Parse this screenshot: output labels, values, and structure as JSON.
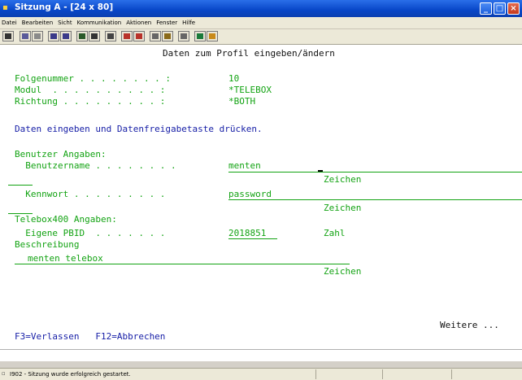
{
  "window": {
    "title": "Sitzung A - [24 x 80]",
    "buttons": [
      "minimize",
      "maximize",
      "close"
    ]
  },
  "menu": [
    "Datei",
    "Bearbeiten",
    "Sicht",
    "Kommunikation",
    "Aktionen",
    "Fenster",
    "Hilfe"
  ],
  "toolbar": {
    "icons": [
      "print-screen-icon",
      "copy-icon",
      "paste-icon",
      "send-icon",
      "receive-icon",
      "display-icon",
      "keyboard-icon",
      "macro-play-icon",
      "record-icon",
      "stop-icon",
      "map-icon",
      "ftp-icon",
      "doc-icon",
      "globe-icon",
      "pencil-icon"
    ]
  },
  "screen": {
    "heading": "Daten zum Profil eingeben/ändern",
    "fields": [
      {
        "label": "Folgenummer . . . . . . . . :",
        "value": "10"
      },
      {
        "label": "Modul  . . . . . . . . . . :",
        "value": "*TELEBOX"
      },
      {
        "label": "Richtung . . . . . . . . . :",
        "value": "*BOTH"
      }
    ],
    "instruction": "Daten eingeben und Datenfreigabetaste drücken.",
    "section_user": "Benutzer Angaben:",
    "username_label": "  Benutzername . . . . . . . .",
    "username_value": "menten",
    "username_hint": "Zeichen",
    "password_label": "  Kennwort . . . . . . . . .",
    "password_value": "password",
    "password_hint": "Zeichen",
    "section_telebox": "Telebox400 Angaben:",
    "pbid_label": "  Eigene PBID  . . . . . . .",
    "pbid_value": "2018851",
    "pbid_hint": "Zahl",
    "description_label": "Beschreibung",
    "description_value": "menten telebox",
    "description_hint": "Zeichen",
    "more": "Weitere ...",
    "fkeys": "F3=Verlassen   F12=Abbrechen"
  },
  "status": {
    "message": "I902 - Sitzung wurde erfolgreich gestartet."
  },
  "colors": {
    "field_green": "#13a313",
    "text_blue": "#151da6",
    "titlebar_blue": "#0846c7"
  }
}
